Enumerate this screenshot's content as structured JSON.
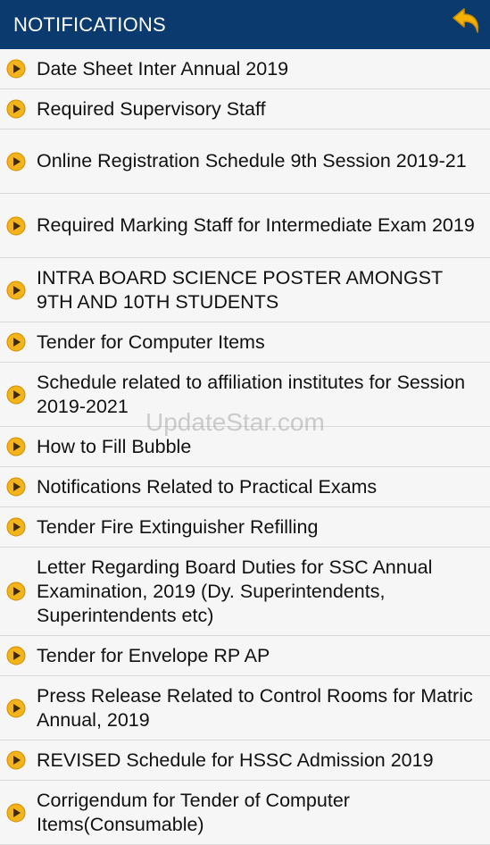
{
  "header": {
    "title": "NOTIFICATIONS",
    "back_icon": "back-arrow-icon",
    "accent": "#0a3a6e",
    "icon_color": "#f5b301"
  },
  "watermark": "UpdateStar.com",
  "notifications": [
    {
      "label": "Date Sheet Inter Annual 2019"
    },
    {
      "label": "Required Supervisory Staff"
    },
    {
      "label": "Online Registration Schedule 9th Session 2019-21"
    },
    {
      "label": "Required Marking Staff for Intermediate Exam 2019"
    },
    {
      "label": "INTRA BOARD SCIENCE POSTER AMONGST 9TH AND 10TH STUDENTS"
    },
    {
      "label": "Tender for Computer Items"
    },
    {
      "label": "Schedule related to affiliation institutes for Session 2019-2021"
    },
    {
      "label": "How to Fill Bubble"
    },
    {
      "label": "Notifications Related to Practical Exams"
    },
    {
      "label": "Tender Fire Extinguisher Refilling"
    },
    {
      "label": "Letter Regarding Board Duties for SSC Annual Examination, 2019 (Dy. Superintendents, Superintendents etc)"
    },
    {
      "label": "Tender for Envelope RP AP"
    },
    {
      "label": "Press Release Related to Control Rooms for Matric Annual, 2019"
    },
    {
      "label": "REVISED Schedule for HSSC Admission 2019"
    },
    {
      "label": "Corrigendum for Tender of Computer Items(Consumable)"
    }
  ]
}
